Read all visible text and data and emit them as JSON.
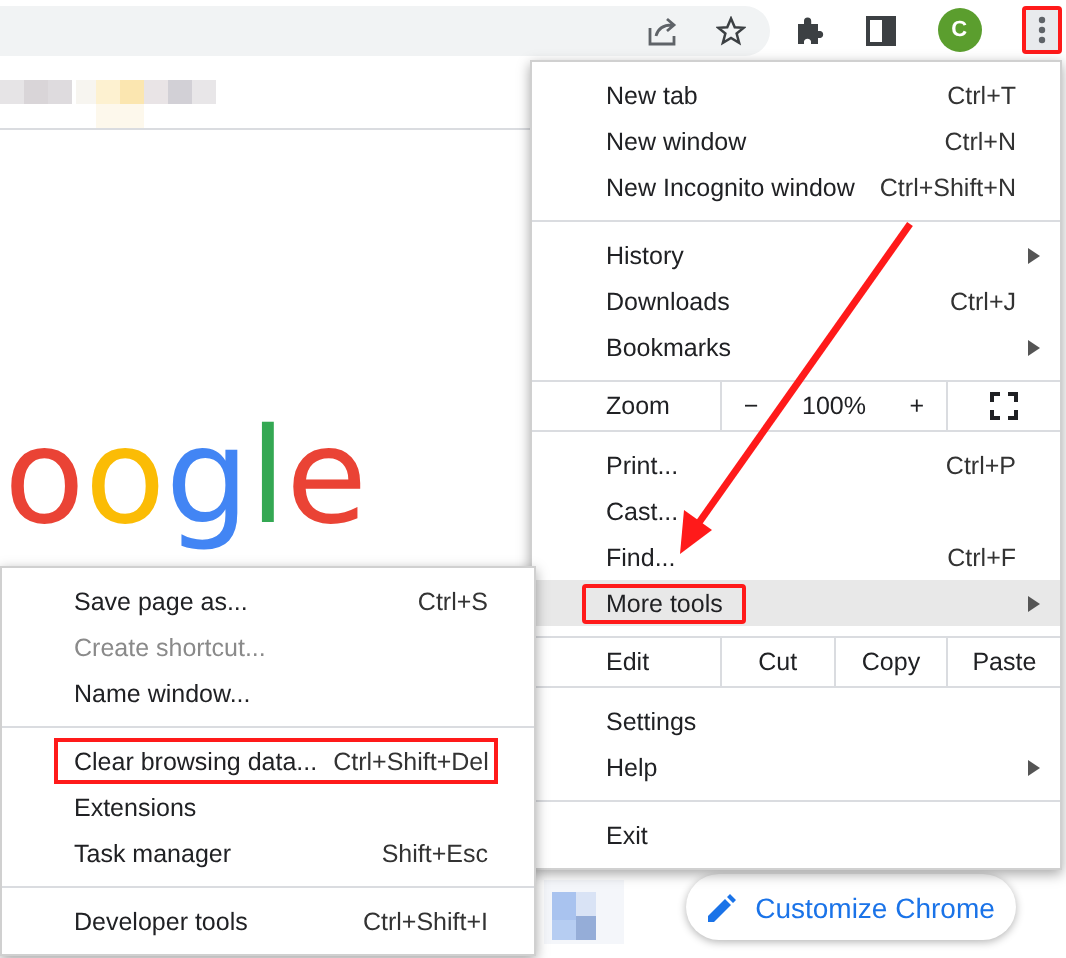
{
  "toolbar": {
    "avatar_letter": "C",
    "menu_button_outlined": true
  },
  "logo": {
    "letters": [
      {
        "text": "o",
        "color": "#ea4335"
      },
      {
        "text": "o",
        "color": "#fbbc05"
      },
      {
        "text": "g",
        "color": "#4285f4"
      },
      {
        "text": "l",
        "color": "#34a853"
      },
      {
        "text": "e",
        "color": "#ea4335"
      }
    ]
  },
  "main_menu": {
    "sections": [
      {
        "items": [
          {
            "kind": "item",
            "label": "New tab",
            "shortcut": "Ctrl+T",
            "has_submenu": false,
            "highlighted": false,
            "outlined": false
          },
          {
            "kind": "item",
            "label": "New window",
            "shortcut": "Ctrl+N",
            "has_submenu": false,
            "highlighted": false,
            "outlined": false
          },
          {
            "kind": "item",
            "label": "New Incognito window",
            "shortcut": "Ctrl+Shift+N",
            "has_submenu": false,
            "highlighted": false,
            "outlined": false
          }
        ]
      },
      {
        "items": [
          {
            "kind": "item",
            "label": "History",
            "has_submenu": true,
            "highlighted": false,
            "outlined": false
          },
          {
            "kind": "item",
            "label": "Downloads",
            "shortcut": "Ctrl+J",
            "has_submenu": false,
            "highlighted": false,
            "outlined": false
          },
          {
            "kind": "item",
            "label": "Bookmarks",
            "has_submenu": true,
            "highlighted": false,
            "outlined": false
          }
        ]
      },
      {
        "items": [
          {
            "kind": "zoom",
            "label": "Zoom",
            "minus": "−",
            "value": "100%",
            "plus": "+"
          }
        ]
      },
      {
        "items": [
          {
            "kind": "item",
            "label": "Print...",
            "shortcut": "Ctrl+P",
            "has_submenu": false,
            "highlighted": false,
            "outlined": false
          },
          {
            "kind": "item",
            "label": "Cast...",
            "has_submenu": false,
            "highlighted": false,
            "outlined": false
          },
          {
            "kind": "item",
            "label": "Find...",
            "shortcut": "Ctrl+F",
            "has_submenu": false,
            "highlighted": false,
            "outlined": false
          },
          {
            "kind": "item",
            "label": "More tools",
            "has_submenu": true,
            "highlighted": true,
            "outlined": true
          }
        ]
      },
      {
        "items": [
          {
            "kind": "edit",
            "label": "Edit",
            "actions": [
              "Cut",
              "Copy",
              "Paste"
            ]
          }
        ]
      },
      {
        "items": [
          {
            "kind": "item",
            "label": "Settings",
            "has_submenu": false,
            "highlighted": false,
            "outlined": false
          },
          {
            "kind": "item",
            "label": "Help",
            "has_submenu": true,
            "highlighted": false,
            "outlined": false
          }
        ]
      },
      {
        "items": [
          {
            "kind": "item",
            "label": "Exit",
            "has_submenu": false,
            "highlighted": false,
            "outlined": false
          }
        ]
      }
    ]
  },
  "submenu": {
    "sections": [
      {
        "items": [
          {
            "label": "Save page as...",
            "shortcut": "Ctrl+S",
            "disabled": false,
            "outlined": false
          },
          {
            "label": "Create shortcut...",
            "disabled": true,
            "outlined": false
          },
          {
            "label": "Name window...",
            "disabled": false,
            "outlined": false
          }
        ]
      },
      {
        "items": [
          {
            "label": "Clear browsing data...",
            "shortcut": "Ctrl+Shift+Del",
            "disabled": false,
            "outlined": true
          },
          {
            "label": "Extensions",
            "disabled": false,
            "outlined": false
          },
          {
            "label": "Task manager",
            "shortcut": "Shift+Esc",
            "disabled": false,
            "outlined": false
          }
        ]
      },
      {
        "items": [
          {
            "label": "Developer tools",
            "shortcut": "Ctrl+Shift+I",
            "disabled": false,
            "outlined": false
          }
        ]
      }
    ]
  },
  "customize_button": {
    "label": "Customize Chrome"
  }
}
